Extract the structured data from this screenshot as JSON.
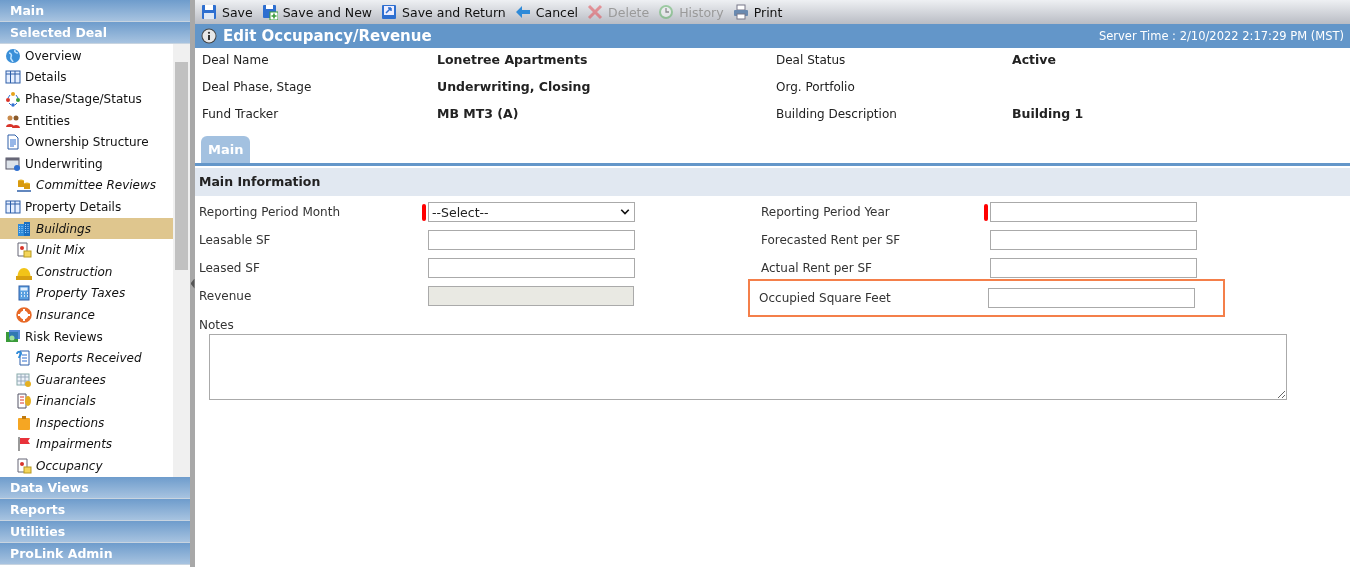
{
  "sidebar": {
    "panels": [
      {
        "title": "Main"
      },
      {
        "title": "Selected Deal",
        "items": [
          {
            "label": "Overview",
            "selected": false
          },
          {
            "label": "Details",
            "selected": false
          },
          {
            "label": "Phase/Stage/Status",
            "selected": false
          },
          {
            "label": "Entities",
            "selected": false
          },
          {
            "label": "Ownership Structure",
            "selected": false
          },
          {
            "label": "Underwriting",
            "selected": false,
            "children": [
              {
                "label": "Committee Reviews",
                "selected": false
              }
            ]
          },
          {
            "label": "Property Details",
            "selected": false,
            "children": [
              {
                "label": "Buildings",
                "selected": true
              },
              {
                "label": "Unit Mix",
                "selected": false
              },
              {
                "label": "Construction",
                "selected": false
              },
              {
                "label": "Property Taxes",
                "selected": false
              },
              {
                "label": "Insurance",
                "selected": false
              }
            ]
          },
          {
            "label": "Risk Reviews",
            "selected": false,
            "children": [
              {
                "label": "Reports Received",
                "selected": false
              },
              {
                "label": "Guarantees",
                "selected": false
              },
              {
                "label": "Financials",
                "selected": false
              },
              {
                "label": "Inspections",
                "selected": false
              },
              {
                "label": "Impairments",
                "selected": false
              },
              {
                "label": "Occupancy",
                "selected": false
              }
            ]
          }
        ]
      },
      {
        "title": "Data Views"
      },
      {
        "title": "Reports"
      },
      {
        "title": "Utilities"
      },
      {
        "title": "ProLink Admin"
      }
    ]
  },
  "toolbar": {
    "buttons": [
      {
        "label": "Save",
        "disabled": false
      },
      {
        "label": "Save and New",
        "disabled": false
      },
      {
        "label": "Save and Return",
        "disabled": false
      },
      {
        "label": "Cancel",
        "disabled": false
      },
      {
        "label": "Delete",
        "disabled": true
      },
      {
        "label": "History",
        "disabled": true
      },
      {
        "label": "Print",
        "disabled": false
      }
    ]
  },
  "header": {
    "title": "Edit Occupancy/Revenue",
    "server_time": "Server Time : 2/10/2022 2:17:29 PM (MST)"
  },
  "summary": [
    {
      "label": "Deal Name",
      "value": "Lonetree Apartments"
    },
    {
      "label": "Deal Status",
      "value": "Active"
    },
    {
      "label": "Deal Phase, Stage",
      "value": "Underwriting, Closing"
    },
    {
      "label": "Org. Portfolio"
    },
    {
      "label": "Fund Tracker",
      "value": "MB MT3 (A)"
    },
    {
      "label": "Building Description",
      "value": "Building 1"
    }
  ],
  "tabs": [
    {
      "label": "Main",
      "selected": true
    }
  ],
  "section": {
    "title": "Main Information",
    "fields": [
      {
        "label": "Reporting Period Month",
        "kind": "select",
        "value": "--Select--",
        "required": true,
        "disabled": false,
        "highlighted": false
      },
      {
        "label": "Reporting Period Year",
        "kind": "text",
        "required": true,
        "disabled": false,
        "highlighted": false
      },
      {
        "label": "Leasable SF",
        "kind": "text",
        "required": false,
        "disabled": false,
        "highlighted": false
      },
      {
        "label": "Forecasted Rent per SF",
        "kind": "text",
        "required": false,
        "disabled": false,
        "highlighted": false
      },
      {
        "label": "Leased SF",
        "kind": "text",
        "required": false,
        "disabled": false,
        "highlighted": false
      },
      {
        "label": "Actual Rent per SF",
        "kind": "text",
        "required": false,
        "disabled": false,
        "highlighted": false
      },
      {
        "label": "Revenue",
        "kind": "text",
        "required": false,
        "disabled": true,
        "highlighted": false
      },
      {
        "label": "Occupied Square Feet",
        "kind": "text",
        "required": false,
        "disabled": false,
        "highlighted": true
      }
    ],
    "notes": {
      "label": "Notes"
    }
  }
}
